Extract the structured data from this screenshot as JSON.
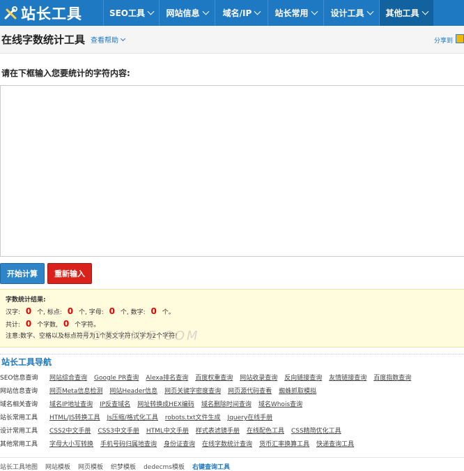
{
  "brand": {
    "logo_text": "站长工具"
  },
  "nav": {
    "items": [
      {
        "label": "SEO工具",
        "active": false
      },
      {
        "label": "网站信息",
        "active": false
      },
      {
        "label": "域名/IP",
        "active": false
      },
      {
        "label": "站长常用",
        "active": false
      },
      {
        "label": "设计工具",
        "active": false
      },
      {
        "label": "其他工具",
        "active": true
      }
    ]
  },
  "header": {
    "title": "在线字数统计工具",
    "help": "查看帮助",
    "share": "分享到"
  },
  "form": {
    "prompt": "请在下框输入您要统计的字符内容:",
    "textarea_value": "",
    "start_button": "开始计算",
    "reset_button": "重新输入"
  },
  "result": {
    "heading": "字数统计结果:",
    "chinese_label": "汉字:",
    "chinese": "0",
    "punct_label": "个, 标点:",
    "punct": "0",
    "letter_label": "个, 字母:",
    "letter": "0",
    "digit_label": "个, 数字:",
    "digit": "0",
    "end1": "个。",
    "total_label": "共计:",
    "total_chars": "0",
    "chars_label": "个字数,",
    "total_bytes": "0",
    "bytes_label": "个字符。",
    "note": "注意:数字、空格以及标点符号为1个英文字符!汉字为2个字符!",
    "watermark": "FOCIVIUE.COM"
  },
  "nav_section": {
    "title": "站长工具导航",
    "rows": [
      {
        "cat": "SEO信息查询",
        "links": [
          "网站综合查询",
          "Google PR查询",
          "Alexa排名查询",
          "百度权重查询",
          "网站收录查询",
          "反向链接查询",
          "友情链接查询",
          "百度指数查询"
        ]
      },
      {
        "cat": "网站信息查询",
        "links": [
          "网页Meta信息检测",
          "网站Header信息",
          "网页关键字密度查询",
          "网页源代码查看",
          "蜘蛛抓取模拟"
        ]
      },
      {
        "cat": "域名相关查询",
        "links": [
          "域名IP地址查询",
          "IP反查域名",
          "网址转换成HEX编码",
          "域名删除时间查询",
          "域名Whois查询"
        ]
      },
      {
        "cat": "站长常用工具",
        "links": [
          "HTML/JS转换工具",
          "Js压缩/格式化工具",
          "robots.txt文件生成",
          "Jquery在线手册"
        ]
      },
      {
        "cat": "设计常用工具",
        "links": [
          "CSS2中文手册",
          "CSS3中文手册",
          "HTML中文手册",
          "样式表滤镜手册",
          "在线配色工具",
          "CSS精简优化工具"
        ]
      },
      {
        "cat": "其他常用工具",
        "links": [
          "字母大小写转换",
          "手机号码归属地查询",
          "身份证查询",
          "在线字数统计查询",
          "货币汇率换算工具",
          "快递查询工具"
        ]
      }
    ]
  },
  "footer": {
    "links": [
      "站长工具地图",
      "网站模板",
      "网页模板",
      "织梦模板",
      "dedecms模板"
    ],
    "highlight": "右键查询工具"
  },
  "colors": {
    "nav_bg": "#1e78c2",
    "accent": "#1e78c2",
    "danger": "#d9221a",
    "result_bg": "#fffbdd"
  }
}
